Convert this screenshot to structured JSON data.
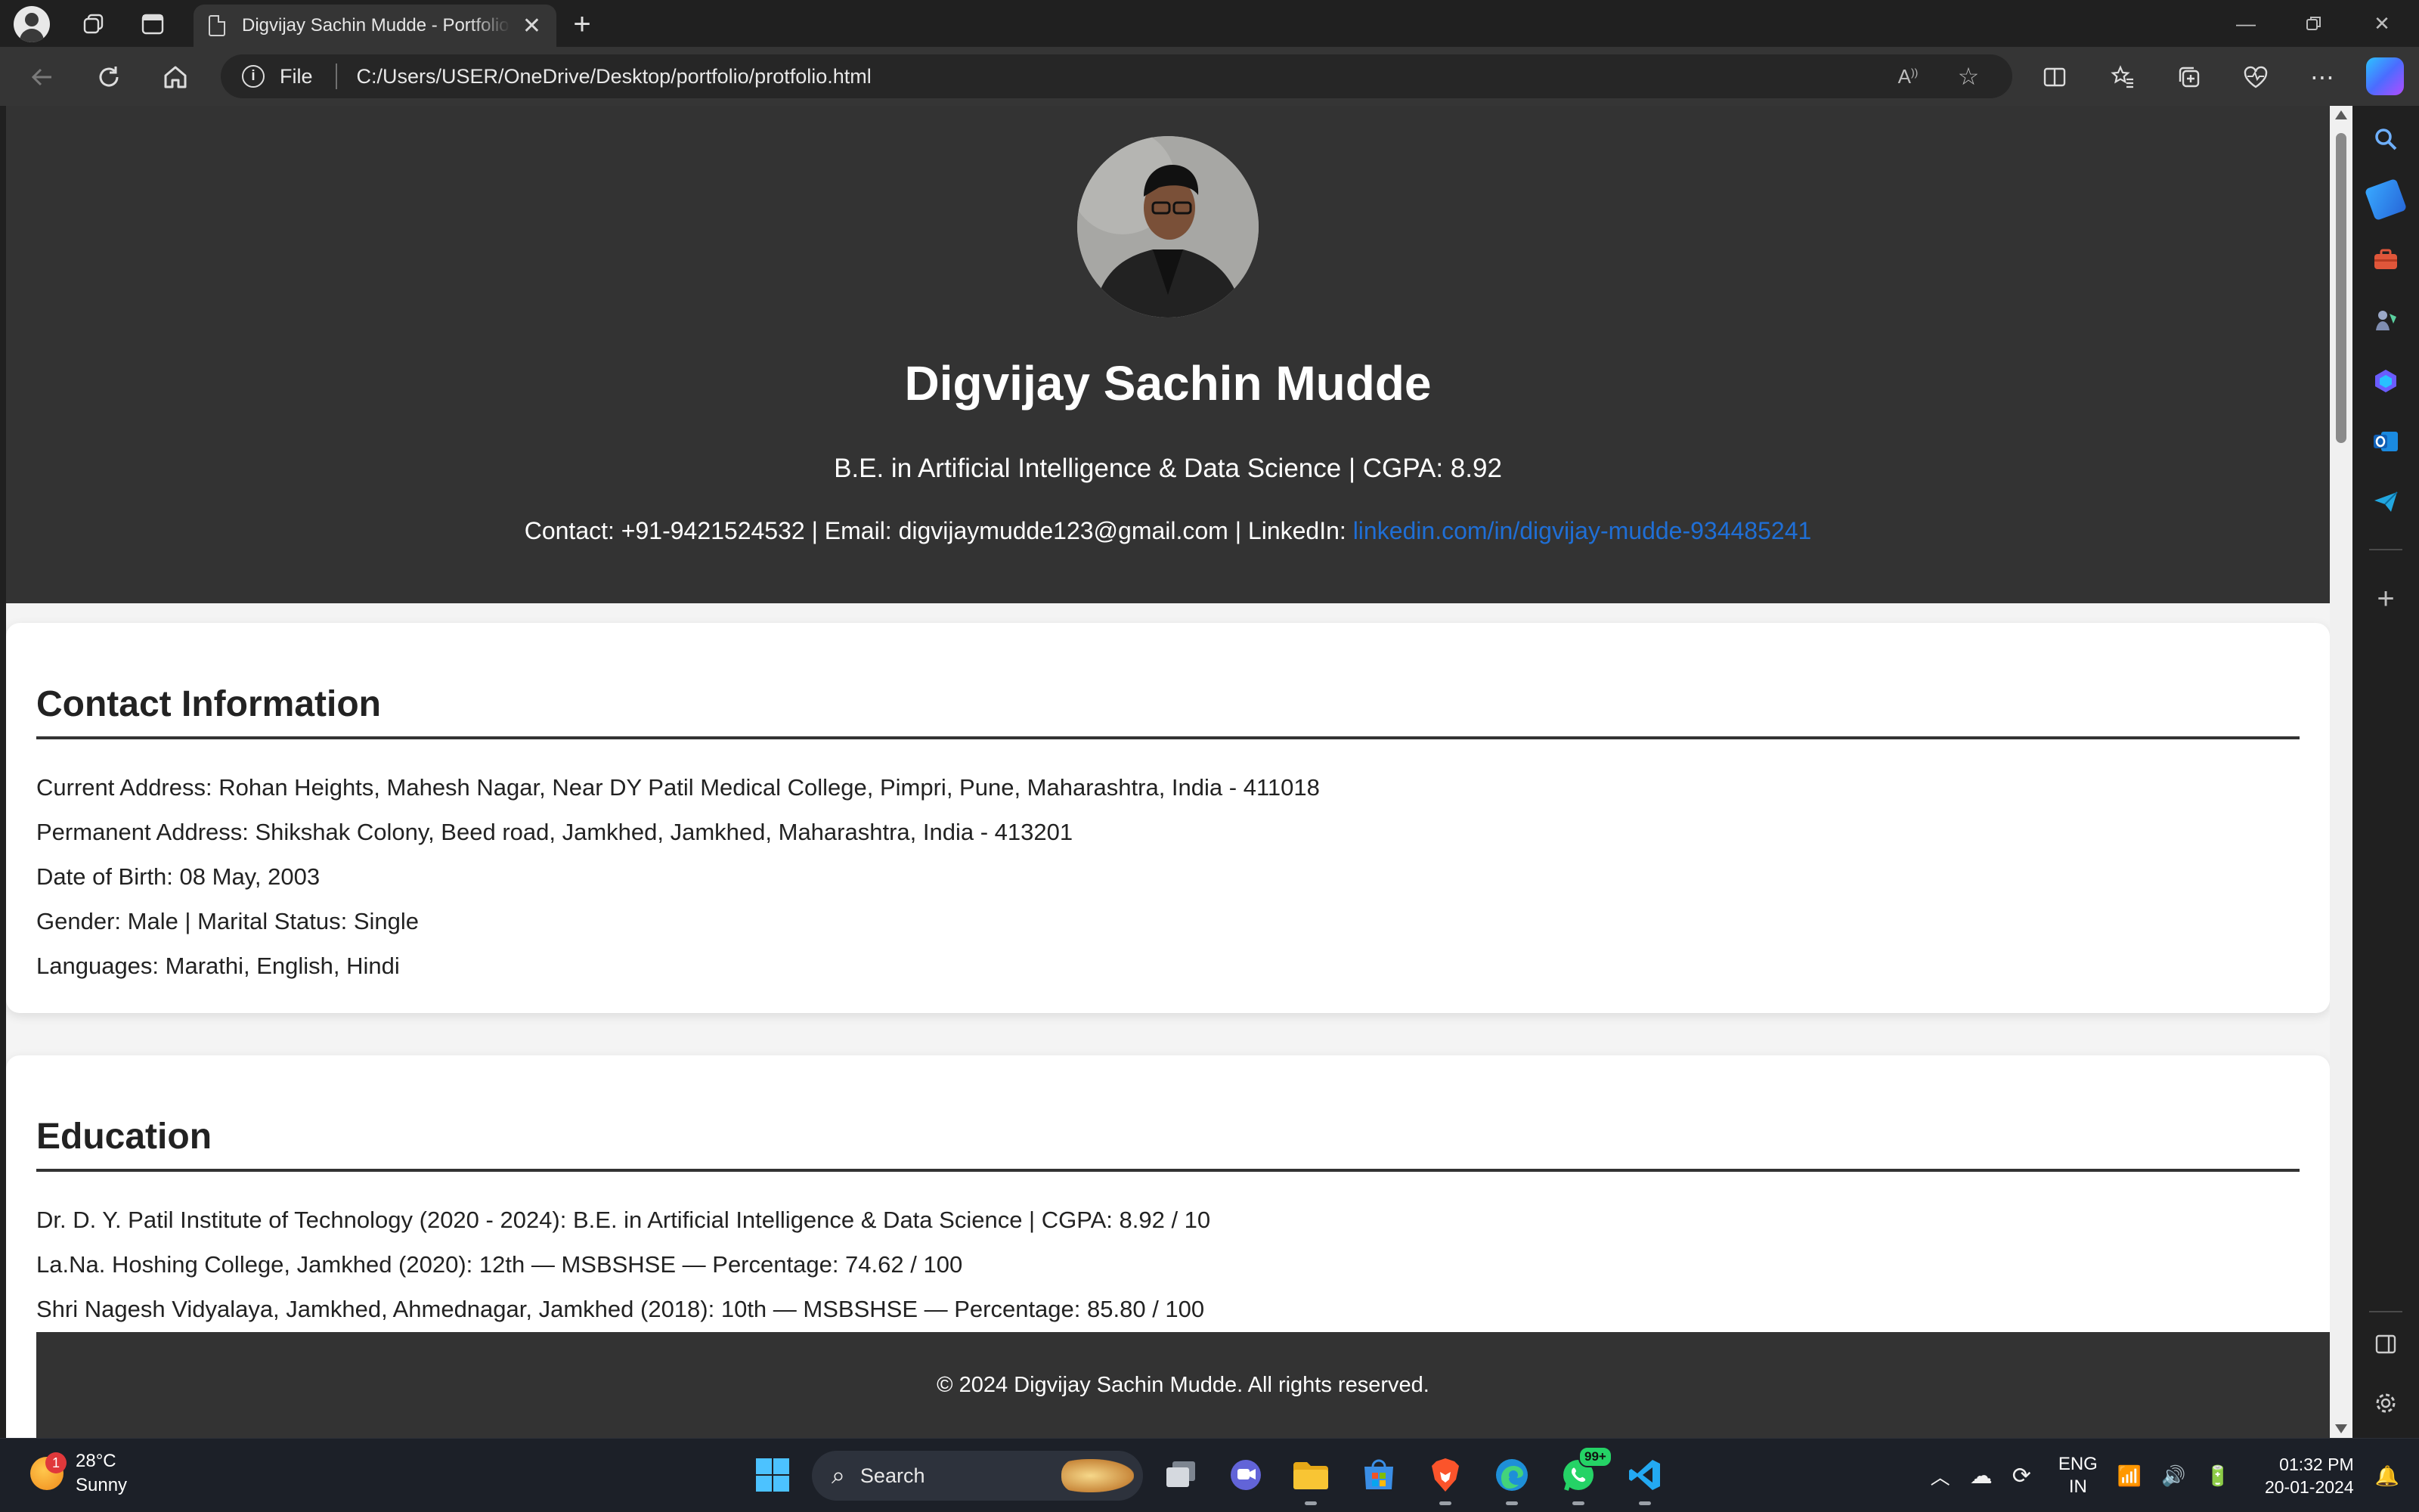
{
  "browser": {
    "tab_title": "Digvijay Sachin Mudde - Portfolio",
    "site_label": "File",
    "url": "C:/Users/USER/OneDrive/Desktop/portfolio/protfolio.html"
  },
  "hero": {
    "name": "Digvijay Sachin Mudde",
    "subtitle": "B.E. in Artificial Intelligence & Data Science | CGPA: 8.92",
    "contact_prefix": "Contact: +91-9421524532 | Email: digvijaymudde123@gmail.com | LinkedIn: ",
    "linkedin": "linkedin.com/in/digvijay-mudde-934485241"
  },
  "contact_section": {
    "title": "Contact Information",
    "lines": [
      "Current Address: Rohan Heights, Mahesh Nagar, Near DY Patil Medical College, Pimpri, Pune, Maharashtra, India - 411018",
      "Permanent Address: Shikshak Colony, Beed road, Jamkhed, Jamkhed, Maharashtra, India - 413201",
      "Date of Birth: 08 May, 2003",
      "Gender: Male | Marital Status: Single",
      "Languages: Marathi, English, Hindi"
    ]
  },
  "education_section": {
    "title": "Education",
    "lines": [
      "Dr. D. Y. Patil Institute of Technology (2020 - 2024): B.E. in Artificial Intelligence & Data Science | CGPA: 8.92 / 10",
      "La.Na. Hoshing College, Jamkhed (2020): 12th — MSBSHSE — Percentage: 74.62 / 100",
      "Shri Nagesh Vidyalaya, Jamkhed, Ahmednagar, Jamkhed (2018): 10th — MSBSHSE — Percentage: 85.80 / 100"
    ]
  },
  "footer": {
    "text": "© 2024 Digvijay Sachin Mudde. All rights reserved."
  },
  "taskbar": {
    "weather_temp": "28°C",
    "weather_desc": "Sunny",
    "weather_badge": "1",
    "search_placeholder": "Search",
    "whatsapp_badge": "99+",
    "lang_top": "ENG",
    "lang_bottom": "IN",
    "time": "01:32 PM",
    "date": "20-01-2024"
  }
}
